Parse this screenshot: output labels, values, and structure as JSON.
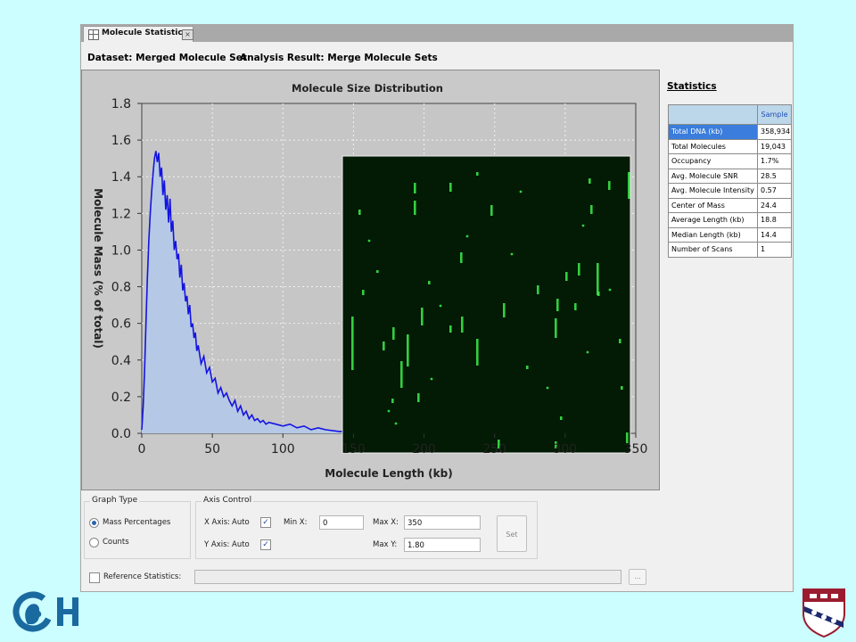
{
  "tab": {
    "title": "Molecule Statistics"
  },
  "header": {
    "dataset": "Dataset: Merged Molecule Set",
    "analysis": "Analysis Result: Merge Molecule Sets"
  },
  "chart_data": {
    "type": "area",
    "title": "Molecule Size Distribution",
    "xlabel": "Molecule Length (kb)",
    "ylabel": "Molecule Mass (% of total)",
    "xlim": [
      0,
      350
    ],
    "ylim": [
      0,
      1.8
    ],
    "xticks": [
      "0",
      "50",
      "100",
      "150",
      "200",
      "250",
      "300",
      "350"
    ],
    "yticks": [
      "0.0",
      "0.2",
      "0.4",
      "0.6",
      "0.8",
      "1.0",
      "1.2",
      "1.4",
      "1.6",
      "1.8"
    ],
    "grid": true,
    "series": [
      {
        "color": "#1414e0",
        "fill": "#b5c8e6",
        "x": [
          0,
          1,
          2,
          3,
          4,
          5,
          6,
          7,
          8,
          9,
          10,
          11,
          12,
          13,
          14,
          15,
          16,
          17,
          18,
          19,
          20,
          21,
          22,
          23,
          24,
          25,
          26,
          27,
          28,
          29,
          30,
          31,
          32,
          33,
          34,
          35,
          36,
          37,
          38,
          39,
          40,
          42,
          44,
          46,
          48,
          50,
          52,
          54,
          56,
          58,
          60,
          62,
          64,
          66,
          68,
          70,
          72,
          74,
          76,
          78,
          80,
          82,
          84,
          86,
          88,
          90,
          95,
          100,
          105,
          110,
          115,
          120,
          125,
          130,
          140,
          150
        ],
        "y": [
          0.02,
          0.15,
          0.35,
          0.6,
          0.85,
          1.05,
          1.2,
          1.32,
          1.42,
          1.5,
          1.54,
          1.48,
          1.53,
          1.4,
          1.45,
          1.3,
          1.38,
          1.22,
          1.3,
          1.15,
          1.28,
          1.1,
          1.16,
          1.0,
          1.05,
          0.95,
          0.98,
          0.85,
          0.92,
          0.78,
          0.82,
          0.72,
          0.75,
          0.65,
          0.7,
          0.58,
          0.6,
          0.52,
          0.55,
          0.45,
          0.48,
          0.38,
          0.42,
          0.33,
          0.36,
          0.28,
          0.3,
          0.22,
          0.25,
          0.2,
          0.22,
          0.18,
          0.15,
          0.18,
          0.12,
          0.15,
          0.1,
          0.12,
          0.08,
          0.1,
          0.07,
          0.08,
          0.06,
          0.07,
          0.05,
          0.06,
          0.05,
          0.04,
          0.05,
          0.03,
          0.04,
          0.02,
          0.03,
          0.02,
          0.01,
          0.01
        ]
      }
    ]
  },
  "statistics": {
    "title": "Statistics",
    "column": "Sample",
    "rows": [
      {
        "label": "Total DNA (kb)",
        "value": "358,934"
      },
      {
        "label": "Total Molecules",
        "value": "19,043"
      },
      {
        "label": "Occupancy",
        "value": "1.7%"
      },
      {
        "label": "Avg. Molecule SNR",
        "value": "28.5"
      },
      {
        "label": "Avg. Molecule Intensity",
        "value": "0.57"
      },
      {
        "label": "Center of Mass",
        "value": "24.4"
      },
      {
        "label": "Average Length (kb)",
        "value": "18.8"
      },
      {
        "label": "Median Length (kb)",
        "value": "14.4"
      },
      {
        "label": "Number of Scans",
        "value": "1"
      }
    ]
  },
  "graph_type": {
    "title": "Graph Type",
    "options": [
      {
        "label": "Mass Percentages",
        "selected": true
      },
      {
        "label": "Counts",
        "selected": false
      }
    ]
  },
  "axis_control": {
    "title": "Axis Control",
    "x_axis_label": "X Axis:",
    "x_axis_mode": "Auto",
    "y_axis_label": "Y Axis:",
    "y_axis_mode": "Auto",
    "min_x_label": "Min X:",
    "min_x_value": "0",
    "max_x_label": "Max X:",
    "max_x_value": "350",
    "max_y_label": "Max Y:",
    "max_y_value": "1.80",
    "set_label": "Set"
  },
  "reference": {
    "label": "Reference Statistics:",
    "browse_label": "..."
  },
  "colors": {
    "background": "#ccfdff",
    "accent": "#3a7ddc",
    "line": "#1414e0",
    "fill": "#b5c8e6",
    "molecule": "#33ff44"
  },
  "logos": {
    "left": "CH",
    "right": "shield"
  }
}
